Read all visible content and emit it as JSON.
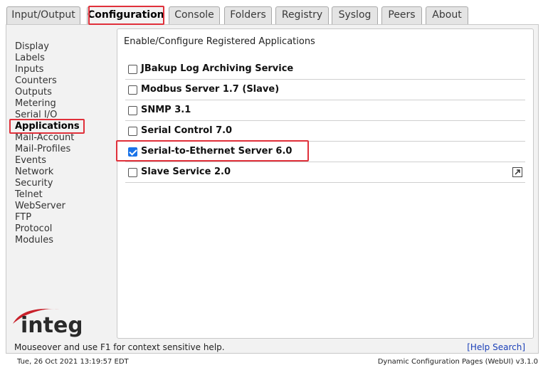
{
  "tabs": [
    {
      "label": "Input/Output"
    },
    {
      "label": "Configuration"
    },
    {
      "label": "Console"
    },
    {
      "label": "Folders"
    },
    {
      "label": "Registry"
    },
    {
      "label": "Syslog"
    },
    {
      "label": "Peers"
    },
    {
      "label": "About"
    }
  ],
  "active_tab": "Configuration",
  "sidebar": {
    "items": [
      {
        "label": "Display"
      },
      {
        "label": "Labels"
      },
      {
        "label": "Inputs"
      },
      {
        "label": "Counters"
      },
      {
        "label": "Outputs"
      },
      {
        "label": "Metering"
      },
      {
        "label": "Serial I/O"
      },
      {
        "label": "Applications"
      },
      {
        "label": "Mail-Account"
      },
      {
        "label": "Mail-Profiles"
      },
      {
        "label": "Events"
      },
      {
        "label": "Network"
      },
      {
        "label": "Security"
      },
      {
        "label": "Telnet"
      },
      {
        "label": "WebServer"
      },
      {
        "label": "FTP"
      },
      {
        "label": "Protocol"
      },
      {
        "label": "Modules"
      }
    ],
    "active": "Applications"
  },
  "main": {
    "title": "Enable/Configure Registered Applications",
    "apps": [
      {
        "label": "JBakup Log Archiving Service",
        "checked": false
      },
      {
        "label": "Modbus Server 1.7 (Slave)",
        "checked": false
      },
      {
        "label": "SNMP 3.1",
        "checked": false
      },
      {
        "label": "Serial Control 7.0",
        "checked": false
      },
      {
        "label": "Serial-to-Ethernet Server 6.0",
        "checked": true
      },
      {
        "label": "Slave Service 2.0",
        "checked": false
      }
    ]
  },
  "logo": {
    "text": "integ"
  },
  "help": {
    "text": "Mouseover and use F1 for context sensitive help.",
    "link": "[Help Search]"
  },
  "footer": {
    "timestamp": "Tue, 26 Oct 2021 13:19:57 EDT",
    "version": "Dynamic Configuration Pages (WebUI) v3.1.0"
  },
  "colors": {
    "highlight": "#e0303a",
    "checkbox": "#1a73e8",
    "logo_red": "#c8202a",
    "link": "#1a3fb8"
  }
}
